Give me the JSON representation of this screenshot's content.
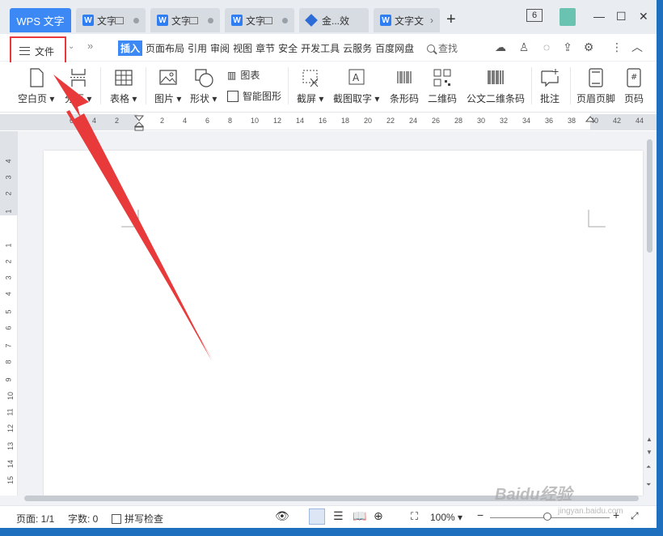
{
  "tabs": [
    {
      "label": "WPS 文字"
    },
    {
      "label": "文字"
    },
    {
      "label": "文字"
    },
    {
      "label": "文字"
    },
    {
      "label": "金...效"
    },
    {
      "label": "文字文"
    }
  ],
  "window": {
    "count_badge": "6"
  },
  "menu": {
    "file_label": "文件",
    "items": [
      "插入",
      "页面布局",
      "引用",
      "审阅",
      "视图",
      "章节",
      "安全",
      "开发工具",
      "云服务",
      "百度网盘"
    ],
    "search_label": "查找"
  },
  "ribbon": {
    "blank_page": "空白页",
    "page_break": "分页",
    "table": "表格",
    "picture": "图片",
    "shape": "形状",
    "chart": "图表",
    "smart_shape": "智能图形",
    "screenshot": "截屏",
    "screenshot_text": "截图取字",
    "barcode": "条形码",
    "qrcode": "二维码",
    "doc_qrcode": "公文二维条码",
    "comment": "批注",
    "header_footer": "页眉页脚",
    "page_number": "页码"
  },
  "ruler": {
    "h_ticks": [
      "6",
      "4",
      "2",
      "2",
      "4",
      "6",
      "8",
      "10",
      "12",
      "14",
      "16",
      "18",
      "20",
      "22",
      "24",
      "26",
      "28",
      "30",
      "32",
      "34",
      "36",
      "38",
      "40",
      "42",
      "44"
    ],
    "v_ticks": [
      "4",
      "3",
      "2",
      "1",
      "1",
      "2",
      "3",
      "4",
      "5",
      "6",
      "7",
      "8",
      "9",
      "10",
      "11",
      "12",
      "13",
      "14",
      "15",
      "16"
    ]
  },
  "status": {
    "page": "页面: 1/1",
    "words": "字数: 0",
    "spell": "拼写检查",
    "zoom": "100%"
  },
  "watermark": {
    "text": "Baidu经验",
    "url_text": "jingyan.baidu.com"
  },
  "colors": {
    "accent": "#3c89f6",
    "highlight_border": "#e83a3a",
    "arrow": "#e83a3a"
  }
}
